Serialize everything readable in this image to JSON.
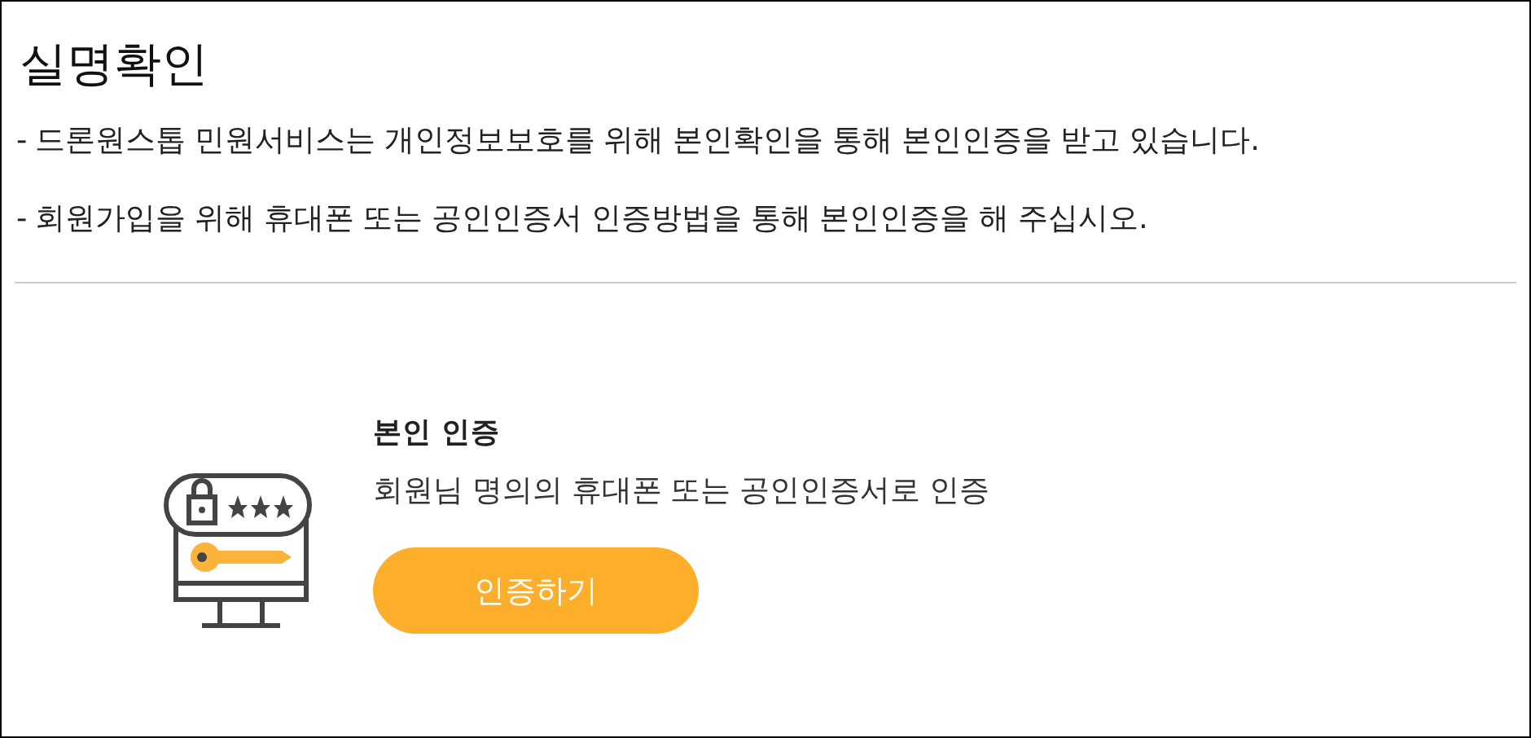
{
  "title": "실명확인",
  "notices": [
    "- 드론원스톱 민원서비스는 개인정보보호를 위해 본인확인을 통해 본인인증을 받고 있습니다.",
    "- 회원가입을 위해 휴대폰 또는 공인인증서 인증방법을 통해 본인인증을 해 주십시오."
  ],
  "verification": {
    "heading": "본인 인증",
    "description": "회원님 명의의 휴대폰 또는 공인인증서로 인증",
    "button": "인증하기"
  }
}
